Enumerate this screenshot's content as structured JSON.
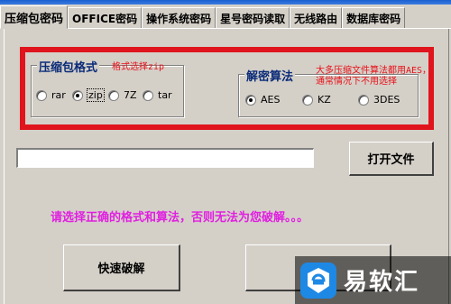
{
  "tabs": [
    {
      "label": "压缩包密码",
      "active": true
    },
    {
      "label": "OFFICE密码",
      "active": false
    },
    {
      "label": "操作系统密码",
      "active": false
    },
    {
      "label": "星号密码读取",
      "active": false
    },
    {
      "label": "无线路由",
      "active": false
    },
    {
      "label": "数据库密码",
      "active": false
    }
  ],
  "format_group": {
    "title": "压缩包格式",
    "hint": "格式选择zip",
    "options": [
      "rar",
      "zip",
      "7Z",
      "tar"
    ],
    "selected": "zip"
  },
  "algo_group": {
    "title": "解密算法",
    "hint_line1": "大多压缩文件算法都用AES，",
    "hint_line2": "通常情况下不用选择",
    "options": [
      "AES",
      "KZ",
      "3DES"
    ],
    "selected": "AES"
  },
  "file_path": {
    "value": ""
  },
  "open_file_button": "打开文件",
  "warning": "请选择正确的格式和算法，否则无法为您破解。。。",
  "quick_crack_button": "快速破解",
  "second_button": "",
  "watermark": {
    "text": "易软汇",
    "accent": "#1e88e5"
  },
  "colors": {
    "highlight_border": "#e0141c",
    "warning_text": "#e020e0",
    "hint_text": "#e81018",
    "group_title": "#0a2a78"
  }
}
